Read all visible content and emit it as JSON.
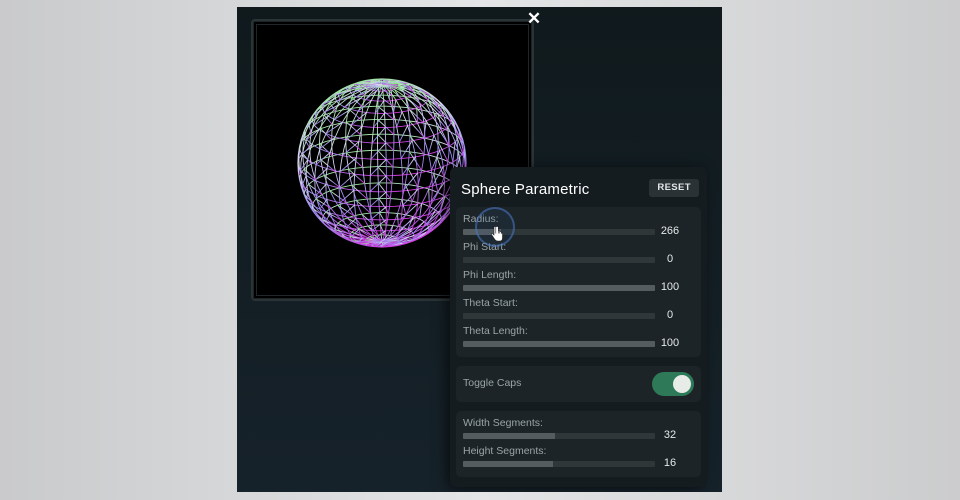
{
  "window": {
    "close_label": "✕"
  },
  "panel": {
    "title": "Sphere Parametric",
    "reset_label": "RESET",
    "sliders": [
      {
        "label": "Radius:",
        "value": "266",
        "fill": 0.2
      },
      {
        "label": "Phi Start:",
        "value": "0",
        "fill": 0
      },
      {
        "label": "Phi Length:",
        "value": "100",
        "fill": 1.0
      },
      {
        "label": "Theta Start:",
        "value": "0",
        "fill": 0
      },
      {
        "label": "Theta Length:",
        "value": "100",
        "fill": 1.0
      }
    ],
    "toggle": {
      "label": "Toggle Caps",
      "on": true
    },
    "segments": [
      {
        "label": "Width Segments:",
        "value": "32",
        "fill": 0.48
      },
      {
        "label": "Height Segments:",
        "value": "16",
        "fill": 0.47
      }
    ]
  },
  "colors": {
    "app_background": "#121c1f",
    "panel_background": "#151c1f",
    "toggle_on": "#2e7a58",
    "sphere_top": "#7fe08a",
    "sphere_bottom": "#c040e0"
  }
}
